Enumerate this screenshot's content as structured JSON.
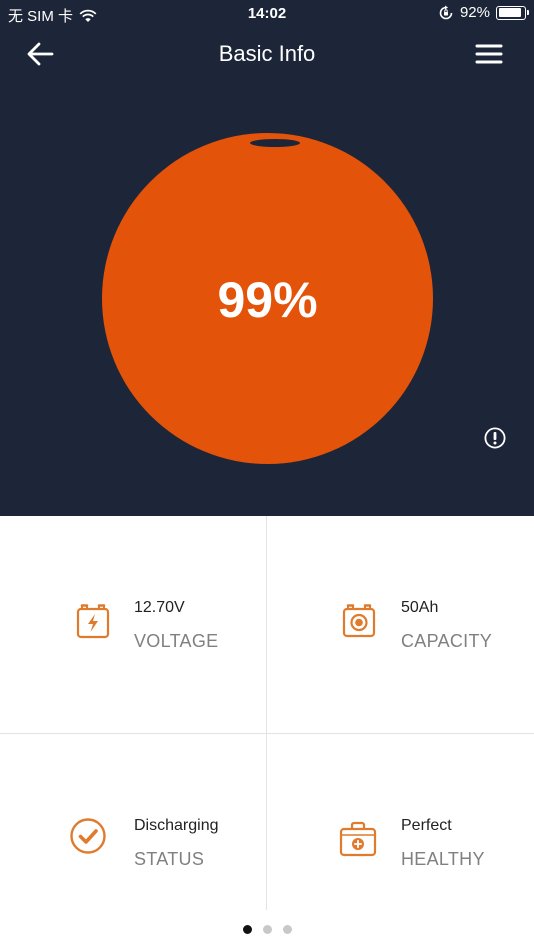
{
  "status_bar": {
    "carrier": "无 SIM 卡",
    "time": "14:02",
    "battery_percent": "92%",
    "battery_level": 0.92
  },
  "header": {
    "title": "Basic Info",
    "back_icon": "arrow-left-icon",
    "menu_icon": "hamburger-menu-icon"
  },
  "gauge": {
    "value_label": "99%",
    "level": 0.99,
    "color": "#e3530a"
  },
  "info_icon": "exclamation-circle-icon",
  "cells": {
    "voltage": {
      "value": "12.70V",
      "label": "VOLTAGE",
      "icon": "battery-bolt-icon"
    },
    "capacity": {
      "value": "50Ah",
      "label": "CAPACITY",
      "icon": "battery-target-icon"
    },
    "status": {
      "value": "Discharging",
      "label": "STATUS",
      "icon": "check-circle-icon"
    },
    "health": {
      "value": "Perfect",
      "label": "HEALTHY",
      "icon": "medical-kit-icon"
    }
  },
  "pager": {
    "count": 3,
    "active": 0
  },
  "colors": {
    "dark_background": "#1d2638",
    "accent": "#e3530a",
    "icon_orange": "#e07a2c"
  }
}
